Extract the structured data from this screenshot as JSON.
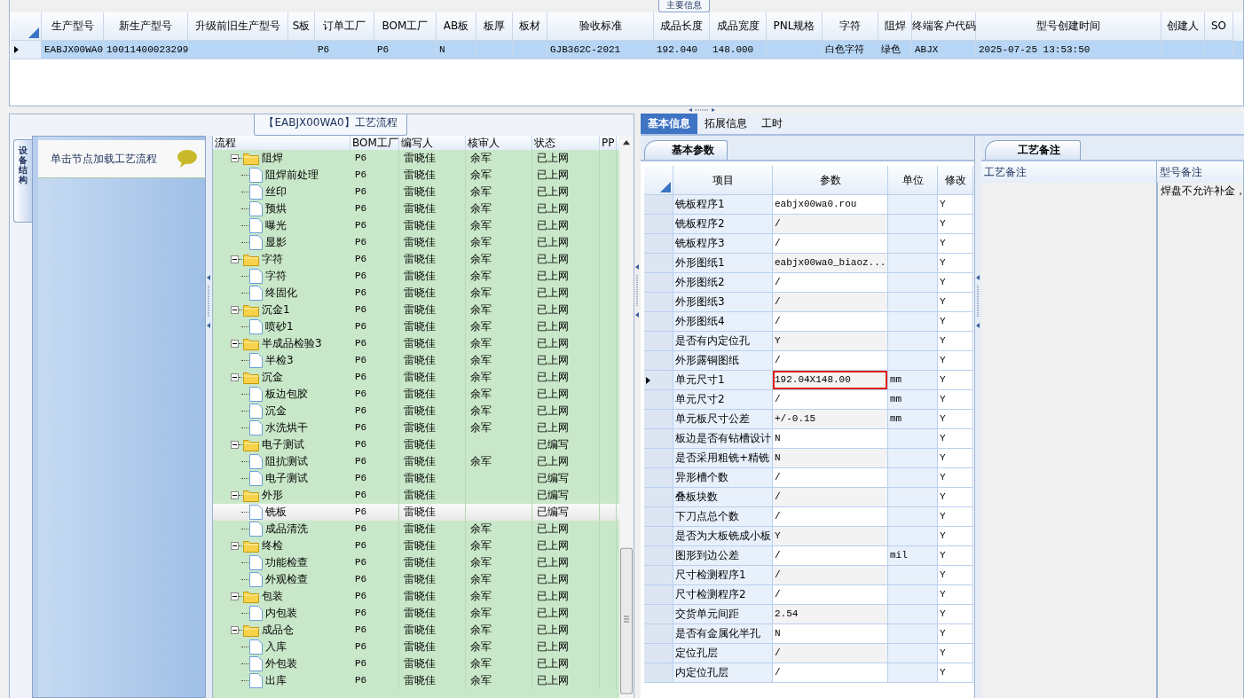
{
  "main_info": {
    "title": "主要信息",
    "columns": [
      "生产型号",
      "新生产型号",
      "升级前旧生产型号",
      "S板",
      "订单工厂",
      "BOM工厂",
      "AB板",
      "板厚",
      "板材",
      "验收标准",
      "成品长度",
      "成品宽度",
      "PNL规格",
      "字符",
      "阻焊",
      "终端客户代码",
      "型号创建时间",
      "创建人",
      "SO"
    ],
    "rows": [
      {
        "selected": true,
        "cells": [
          "EABJX00WA0",
          "10011400023299",
          null,
          null,
          "P6",
          "P6",
          "N",
          null,
          null,
          "GJB362C-2021",
          "192.040",
          "148.000",
          null,
          "白色字符",
          "绿色",
          "ABJX",
          "2025-07-25 13:53:50",
          null,
          null
        ]
      }
    ]
  },
  "process": {
    "title": "【EABJX00WA0】工艺流程",
    "side_tab": {
      "label": "设备结构",
      "selected": true
    },
    "side_panel": {
      "heading": "单击节点加载工艺流程"
    },
    "tree": {
      "columns": [
        "流程",
        "BOM工厂",
        "编写人",
        "核审人",
        "状态",
        "PP"
      ],
      "nodes": [
        {
          "label": "阻焊",
          "bom": "P6",
          "writer": "雷晓佳",
          "reviewer": "余军",
          "status": "已上网",
          "expanded": true,
          "selected": false,
          "children": [
            {
              "label": "阻焊前处理",
              "bom": "P6",
              "writer": "雷晓佳",
              "reviewer": "余军",
              "status": "已上网",
              "selected": false
            },
            {
              "label": "丝印",
              "bom": "P6",
              "writer": "雷晓佳",
              "reviewer": "余军",
              "status": "已上网",
              "selected": false
            },
            {
              "label": "预烘",
              "bom": "P6",
              "writer": "雷晓佳",
              "reviewer": "余军",
              "status": "已上网",
              "selected": false
            },
            {
              "label": "曝光",
              "bom": "P6",
              "writer": "雷晓佳",
              "reviewer": "余军",
              "status": "已上网",
              "selected": false
            },
            {
              "label": "显影",
              "bom": "P6",
              "writer": "雷晓佳",
              "reviewer": "余军",
              "status": "已上网",
              "selected": false
            }
          ]
        },
        {
          "label": "字符",
          "bom": "P6",
          "writer": "雷晓佳",
          "reviewer": "余军",
          "status": "已上网",
          "expanded": true,
          "selected": false,
          "children": [
            {
              "label": "字符",
              "bom": "P6",
              "writer": "雷晓佳",
              "reviewer": "余军",
              "status": "已上网",
              "selected": false
            },
            {
              "label": "终固化",
              "bom": "P6",
              "writer": "雷晓佳",
              "reviewer": "余军",
              "status": "已上网",
              "selected": false
            }
          ]
        },
        {
          "label": "沉金1",
          "bom": "P6",
          "writer": "雷晓佳",
          "reviewer": "余军",
          "status": "已上网",
          "expanded": true,
          "selected": false,
          "children": [
            {
              "label": "喷砂1",
              "bom": "P6",
              "writer": "雷晓佳",
              "reviewer": "余军",
              "status": "已上网",
              "selected": false
            }
          ]
        },
        {
          "label": "半成品检验3",
          "bom": "P6",
          "writer": "雷晓佳",
          "reviewer": "余军",
          "status": "已上网",
          "expanded": true,
          "selected": false,
          "children": [
            {
              "label": "半检3",
              "bom": "P6",
              "writer": "雷晓佳",
              "reviewer": "余军",
              "status": "已上网",
              "selected": false
            }
          ]
        },
        {
          "label": "沉金",
          "bom": "P6",
          "writer": "雷晓佳",
          "reviewer": "余军",
          "status": "已上网",
          "expanded": true,
          "selected": false,
          "children": [
            {
              "label": "板边包胶",
              "bom": "P6",
              "writer": "雷晓佳",
              "reviewer": "余军",
              "status": "已上网",
              "selected": false
            },
            {
              "label": "沉金",
              "bom": "P6",
              "writer": "雷晓佳",
              "reviewer": "余军",
              "status": "已上网",
              "selected": false
            },
            {
              "label": "水洗烘干",
              "bom": "P6",
              "writer": "雷晓佳",
              "reviewer": "余军",
              "status": "已上网",
              "selected": false
            }
          ]
        },
        {
          "label": "电子测试",
          "bom": "P6",
          "writer": "雷晓佳",
          "status": "已编写",
          "expanded": true,
          "selected": false,
          "children": [
            {
              "label": "阻抗测试",
              "bom": "P6",
              "writer": "雷晓佳",
              "reviewer": "余军",
              "status": "已上网",
              "selected": false
            },
            {
              "label": "电子测试",
              "bom": "P6",
              "writer": "雷晓佳",
              "status": "已编写",
              "selected": false
            }
          ]
        },
        {
          "label": "外形",
          "bom": "P6",
          "writer": "雷晓佳",
          "status": "已编写",
          "expanded": true,
          "selected": false,
          "children": [
            {
              "label": "铣板",
              "bom": "P6",
              "writer": "雷晓佳",
              "status": "已编写",
              "selected": true
            },
            {
              "label": "成品清洗",
              "bom": "P6",
              "writer": "雷晓佳",
              "reviewer": "余军",
              "status": "已上网",
              "selected": false
            }
          ]
        },
        {
          "label": "终检",
          "bom": "P6",
          "writer": "雷晓佳",
          "reviewer": "余军",
          "status": "已上网",
          "expanded": true,
          "selected": false,
          "children": [
            {
              "label": "功能检查",
              "bom": "P6",
              "writer": "雷晓佳",
              "reviewer": "余军",
              "status": "已上网",
              "selected": false
            },
            {
              "label": "外观检查",
              "bom": "P6",
              "writer": "雷晓佳",
              "reviewer": "余军",
              "status": "已上网",
              "selected": false
            }
          ]
        },
        {
          "label": "包装",
          "bom": "P6",
          "writer": "雷晓佳",
          "reviewer": "余军",
          "status": "已上网",
          "expanded": true,
          "selected": false,
          "children": [
            {
              "label": "内包装",
              "bom": "P6",
              "writer": "雷晓佳",
              "reviewer": "余军",
              "status": "已上网",
              "selected": false
            }
          ]
        },
        {
          "label": "成品仓",
          "bom": "P6",
          "writer": "雷晓佳",
          "reviewer": "余军",
          "status": "已上网",
          "expanded": true,
          "selected": false,
          "children": [
            {
              "label": "入库",
              "bom": "P6",
              "writer": "雷晓佳",
              "reviewer": "余军",
              "status": "已上网",
              "selected": false
            },
            {
              "label": "外包装",
              "bom": "P6",
              "writer": "雷晓佳",
              "reviewer": "余军",
              "status": "已上网",
              "selected": false
            },
            {
              "label": "出库",
              "bom": "P6",
              "writer": "雷晓佳",
              "reviewer": "余军",
              "status": "已上网",
              "selected": false
            }
          ]
        }
      ]
    }
  },
  "detail": {
    "tabs": [
      {
        "label": "基本信息",
        "selected": true
      },
      {
        "label": "拓展信息",
        "selected": false
      },
      {
        "label": "工时",
        "selected": false
      }
    ],
    "params": {
      "tab": {
        "label": "基本参数",
        "selected": true
      },
      "columns": [
        "项目",
        "参数",
        "单位",
        "修改"
      ],
      "rows": [
        {
          "item": "铣板程序1",
          "value": "eabjx00wa0.rou",
          "modified": "Y",
          "selected": false,
          "annotated": false
        },
        {
          "item": "铣板程序2",
          "value": "/",
          "modified": "Y",
          "selected": false,
          "annotated": false
        },
        {
          "item": "铣板程序3",
          "value": "/",
          "modified": "Y",
          "selected": false,
          "annotated": false
        },
        {
          "item": "外形图纸1",
          "value": "eabjx00wa0_biaoz...",
          "modified": "Y",
          "selected": false,
          "annotated": false
        },
        {
          "item": "外形图纸2",
          "value": "/",
          "modified": "Y",
          "selected": false,
          "annotated": false
        },
        {
          "item": "外形图纸3",
          "value": "/",
          "modified": "Y",
          "selected": false,
          "annotated": false
        },
        {
          "item": "外形图纸4",
          "value": "/",
          "modified": "Y",
          "selected": false,
          "annotated": false
        },
        {
          "item": "是否有内定位孔",
          "value": "Y",
          "modified": "Y",
          "selected": false,
          "annotated": false
        },
        {
          "item": "外形露铜图纸",
          "value": "/",
          "modified": "Y",
          "selected": false,
          "annotated": false
        },
        {
          "item": "单元尺寸1",
          "value": "192.04X148.00",
          "unit": "mm",
          "modified": "Y",
          "selected": true,
          "annotated": true
        },
        {
          "item": "单元尺寸2",
          "value": "/",
          "unit": "mm",
          "modified": "Y",
          "selected": false,
          "annotated": false
        },
        {
          "item": "单元板尺寸公差",
          "value": "+/-0.15",
          "unit": "mm",
          "modified": "Y",
          "selected": false,
          "annotated": false
        },
        {
          "item": "板边是否有钻槽设计",
          "value": "N",
          "modified": "Y",
          "selected": false,
          "annotated": false
        },
        {
          "item": "是否采用粗铣+精铣",
          "value": "N",
          "modified": "Y",
          "selected": false,
          "annotated": false
        },
        {
          "item": "异形槽个数",
          "value": "/",
          "modified": "Y",
          "selected": false,
          "annotated": false
        },
        {
          "item": "叠板块数",
          "value": "/",
          "modified": "Y",
          "selected": false,
          "annotated": false
        },
        {
          "item": "下刀点总个数",
          "value": "/",
          "modified": "Y",
          "selected": false,
          "annotated": false
        },
        {
          "item": "是否为大板铣成小板",
          "value": "Y",
          "modified": "Y",
          "selected": false,
          "annotated": false
        },
        {
          "item": "图形到边公差",
          "value": "/",
          "unit": "mil",
          "modified": "Y",
          "selected": false,
          "annotated": false
        },
        {
          "item": "尺寸检测程序1",
          "value": "/",
          "modified": "Y",
          "selected": false,
          "annotated": false
        },
        {
          "item": "尺寸检测程序2",
          "value": "/",
          "modified": "Y",
          "selected": false,
          "annotated": false
        },
        {
          "item": "交货单元间距",
          "value": "2.54",
          "modified": "Y",
          "selected": false,
          "annotated": false
        },
        {
          "item": "是否有金属化半孔",
          "value": "N",
          "modified": "Y",
          "selected": false,
          "annotated": false
        },
        {
          "item": "定位孔层",
          "value": "/",
          "modified": "Y",
          "selected": false,
          "annotated": false
        },
        {
          "item": "内定位孔层",
          "value": "/",
          "modified": "Y",
          "selected": false,
          "annotated": false
        }
      ]
    },
    "notes": {
      "tab": {
        "label": "工艺备注",
        "selected": true
      },
      "columns": [
        "工艺备注",
        "型号备注"
      ],
      "model_note": "焊盘不允许补金，"
    }
  }
}
